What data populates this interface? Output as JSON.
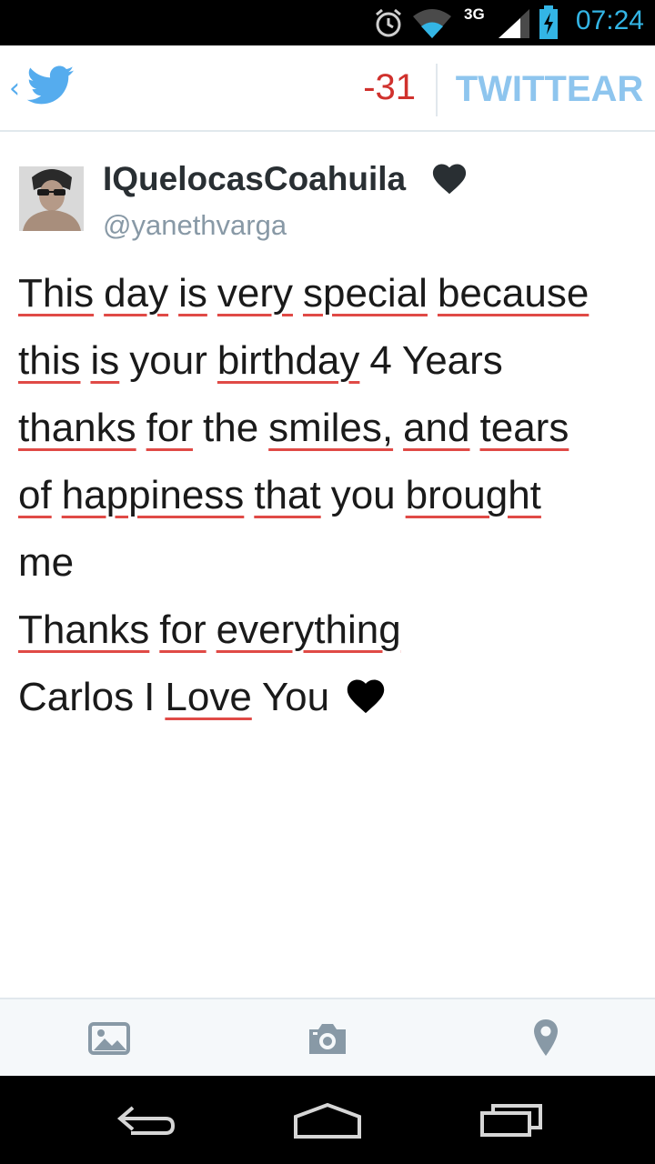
{
  "status_bar": {
    "time": "07:24",
    "network": "3G",
    "icons": [
      "alarm-icon",
      "wifi-icon",
      "signal-icon",
      "battery-charging-icon"
    ],
    "accent_color": "#33b5e5"
  },
  "action_bar": {
    "char_count": "-31",
    "tweet_button_label": "TWITTEAR",
    "brand_color": "#55acee",
    "counter_color": "#d0312d"
  },
  "compose": {
    "display_name": "IQuelocasCoahuila",
    "handle": "@yanethvarga",
    "lines": [
      [
        "This",
        "day",
        "is",
        "very",
        "special",
        "because"
      ],
      [
        "this",
        "is",
        "your",
        "birthday",
        "4",
        "Years"
      ],
      [
        "thanks",
        "for",
        "the",
        "smiles,",
        "and",
        "tears"
      ],
      [
        "of",
        "happiness",
        "that",
        "you",
        "brought"
      ],
      [
        "me"
      ],
      [
        "Thanks",
        "for",
        "everything"
      ],
      [
        "Carlos",
        "I",
        "Love",
        "You"
      ]
    ],
    "spellcheck_color": "#e04a46"
  },
  "toolbar": {
    "icons": [
      "gallery-icon",
      "camera-icon",
      "location-icon"
    ]
  },
  "nav_bar": {
    "icons": [
      "back-icon",
      "home-icon",
      "recent-apps-icon"
    ]
  }
}
